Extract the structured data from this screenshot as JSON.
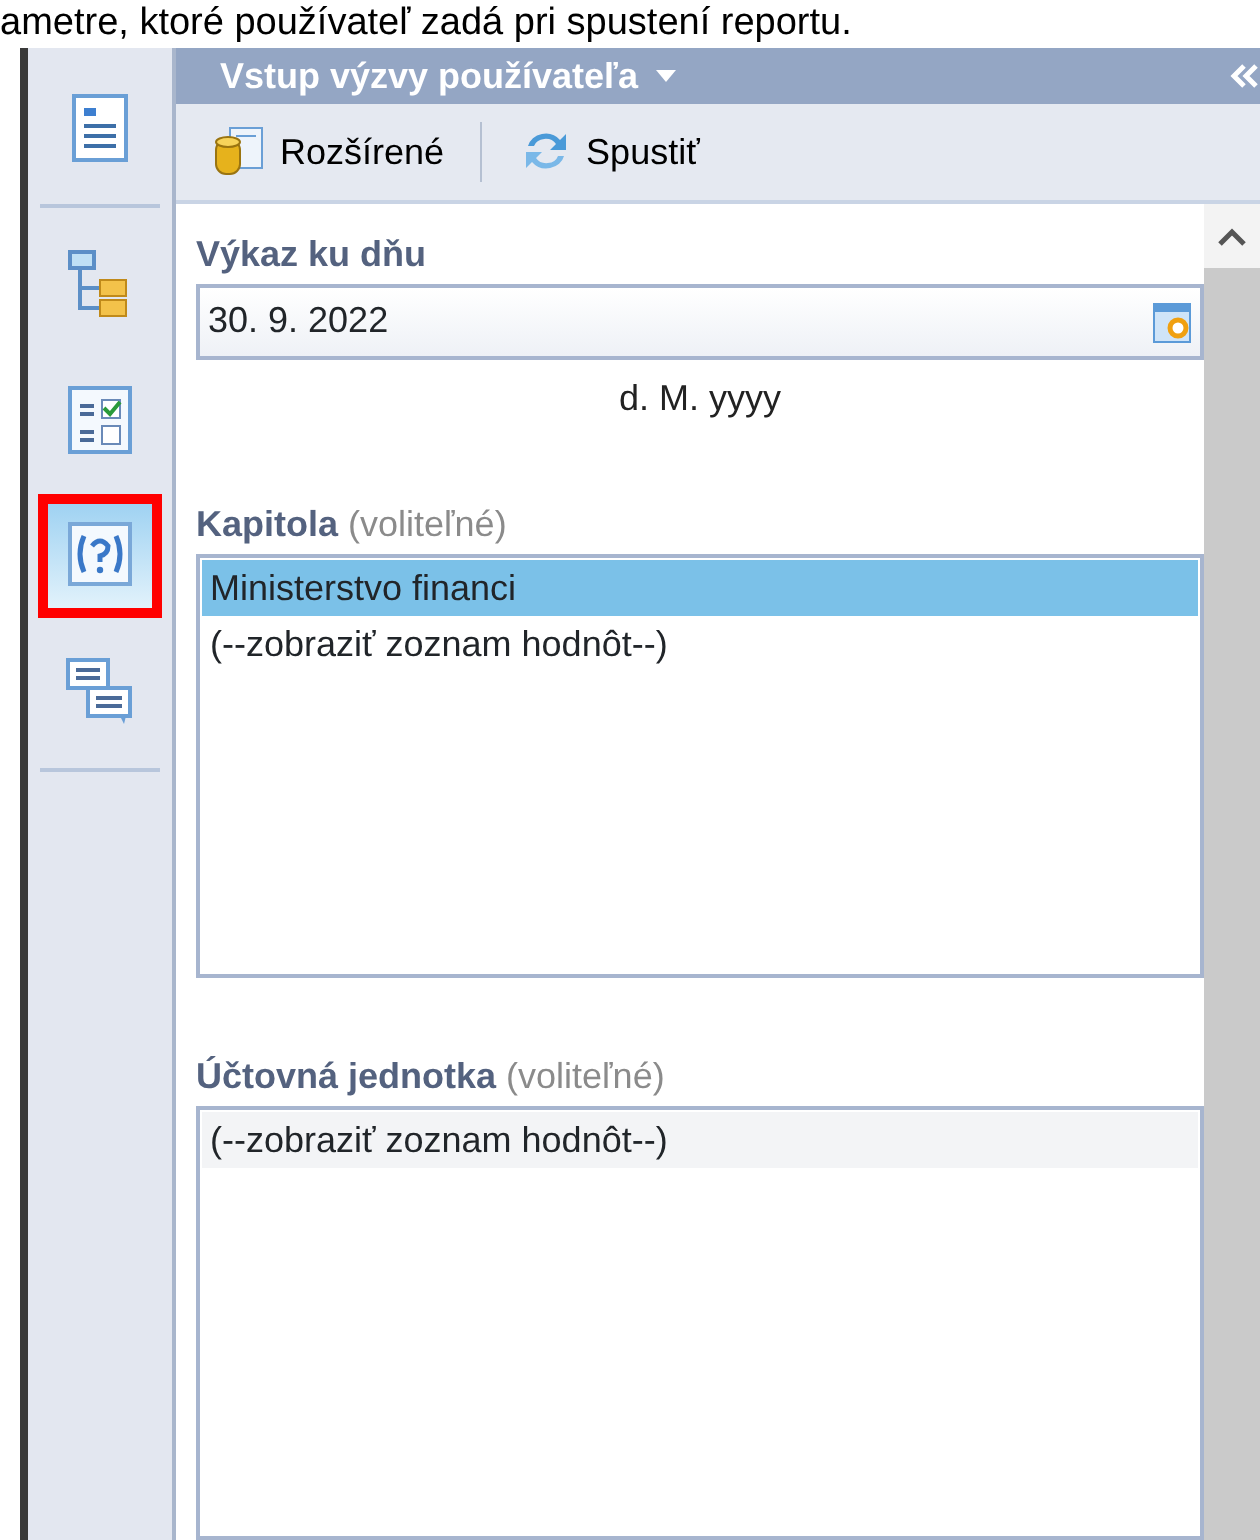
{
  "caption": "ametre, ktoré používateľ zadá pri spustení reportu.",
  "sidebar": {
    "items": [
      {
        "kind": "report",
        "selected": false,
        "divider_after": true
      },
      {
        "kind": "tree",
        "selected": false,
        "divider_after": false
      },
      {
        "kind": "checklist",
        "selected": false,
        "divider_after": false
      },
      {
        "kind": "help",
        "selected": true,
        "marked": true,
        "divider_after": false
      },
      {
        "kind": "chat",
        "selected": false,
        "divider_after": true
      }
    ]
  },
  "panel": {
    "title": "Vstup výzvy používateľa",
    "toolbar": [
      {
        "kind": "advanced",
        "label": "Rozšírené"
      },
      {
        "kind": "run",
        "label": "Spustiť"
      }
    ],
    "fields": [
      {
        "kind": "date",
        "label": "Výkaz ku dňu",
        "value": "30. 9. 2022",
        "format": "d. M. yyyy"
      },
      {
        "kind": "list",
        "label": "Kapitola",
        "hint": "(voliteľné)",
        "items": [
          {
            "text": "Ministerstvo financi",
            "selected": true,
            "focused": false
          },
          {
            "text": "(--zobraziť zoznam hodnôt--)",
            "selected": false,
            "focused": false
          }
        ]
      },
      {
        "kind": "list",
        "label": "Účtovná jednotka",
        "hint": "(voliteľné)",
        "items": [
          {
            "text": "(--zobraziť zoznam hodnôt--)",
            "selected": false,
            "focused": true
          }
        ]
      }
    ]
  }
}
